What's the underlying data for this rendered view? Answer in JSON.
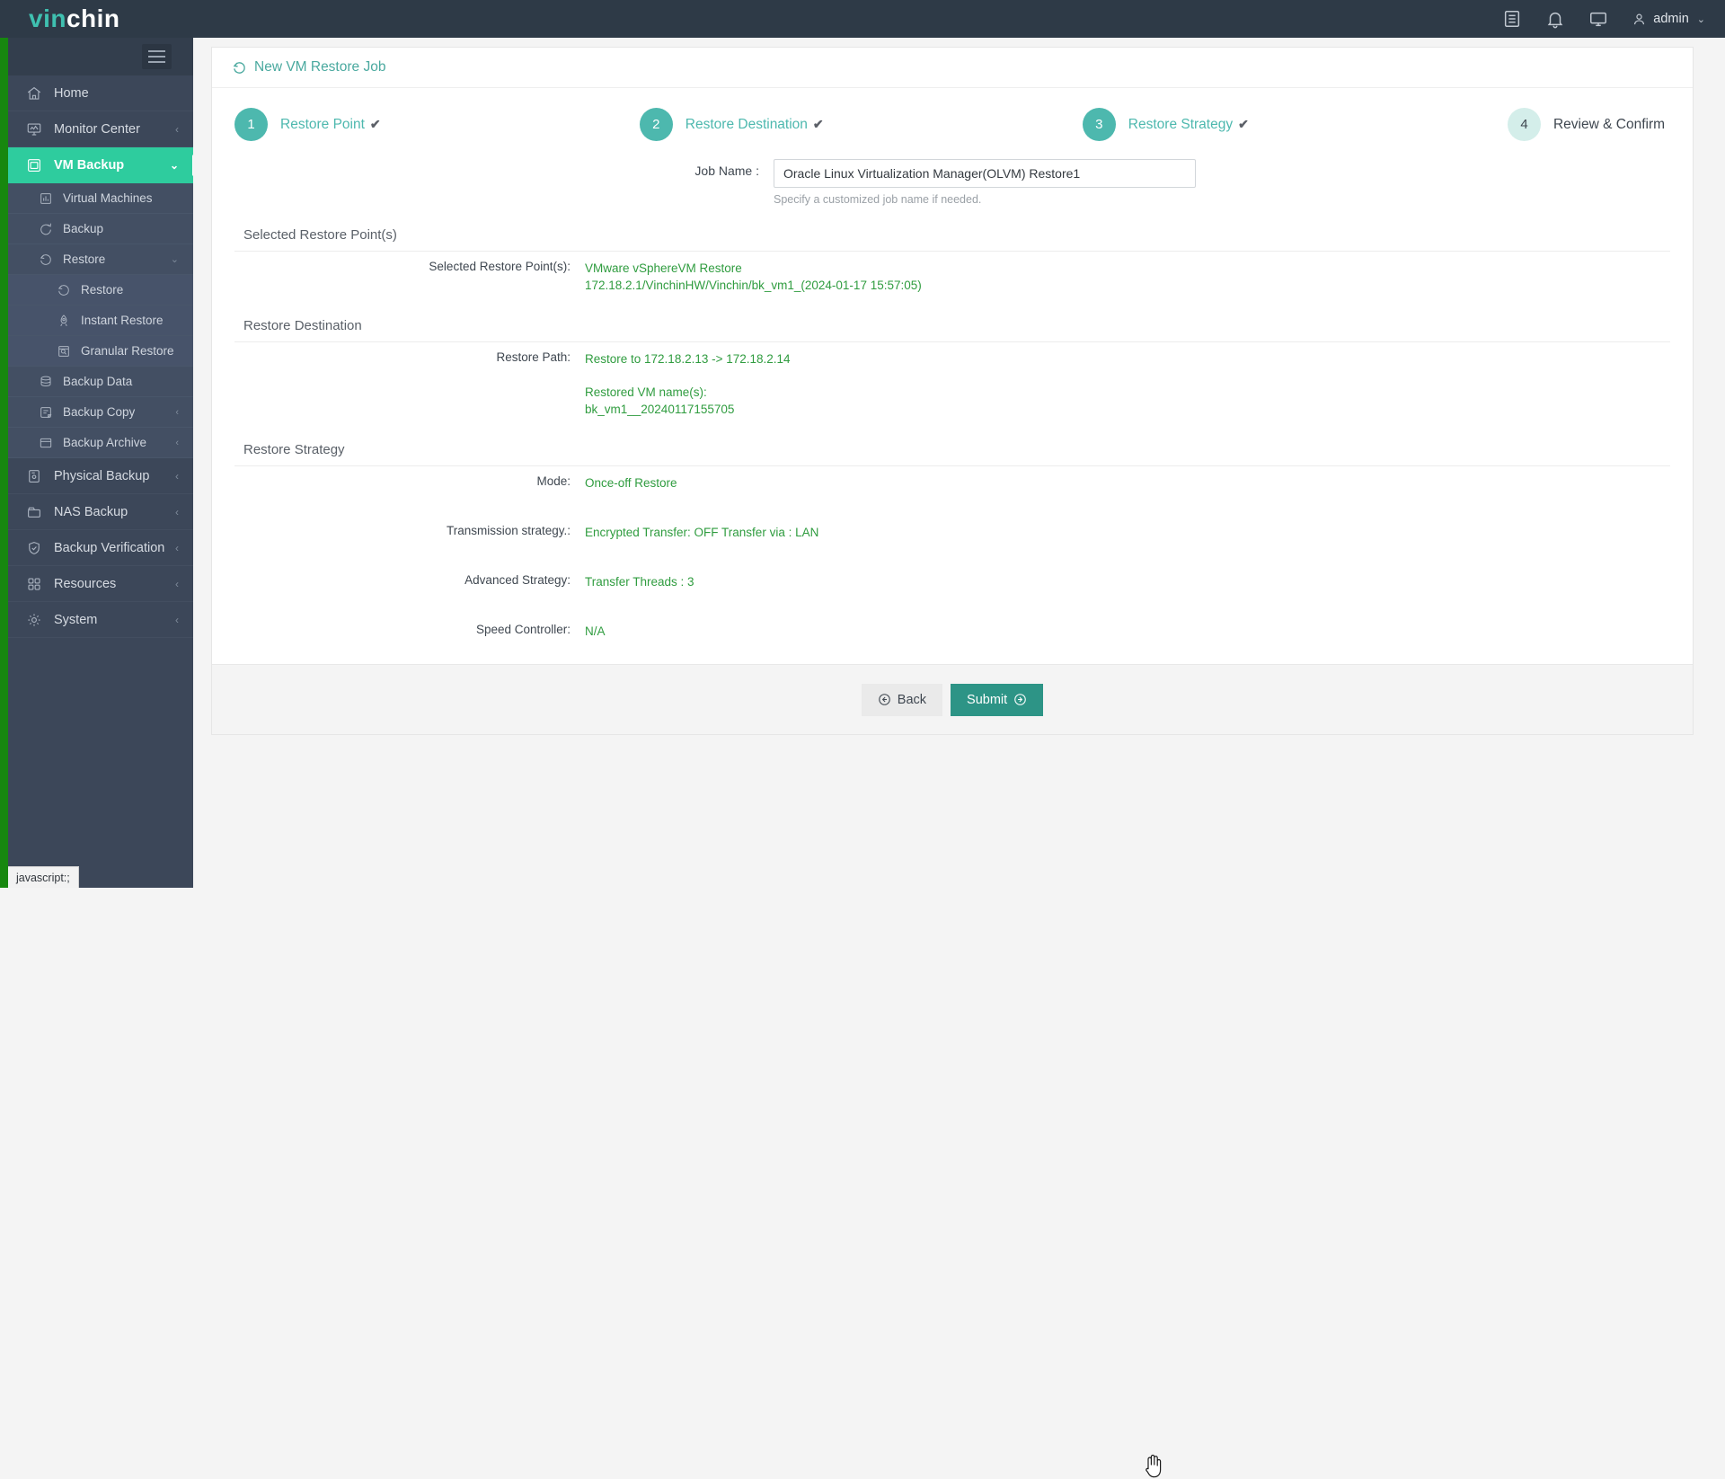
{
  "header": {
    "logo_part1": "vin",
    "logo_part2": "chin",
    "icons": [
      "list-icon",
      "bell-icon",
      "monitor-icon"
    ],
    "user_name": "admin",
    "user_chevron": "⌄"
  },
  "sidebar": {
    "toggle": "hamburger-icon",
    "items": [
      {
        "label": "Home",
        "icon": "home-icon",
        "arrow": "",
        "level": 0,
        "active": false
      },
      {
        "label": "Monitor Center",
        "icon": "monitor-chart-icon",
        "arrow": "‹",
        "level": 0,
        "active": false
      },
      {
        "label": "VM Backup",
        "icon": "vm-icon",
        "arrow": "⌄",
        "level": 0,
        "active": true
      },
      {
        "label": "Virtual Machines",
        "icon": "grid-icon",
        "arrow": "",
        "level": 1,
        "active": false
      },
      {
        "label": "Backup",
        "icon": "refresh-icon",
        "arrow": "",
        "level": 1,
        "active": false
      },
      {
        "label": "Restore",
        "icon": "restore-icon",
        "arrow": "⌄",
        "level": 1,
        "active": false
      },
      {
        "label": "Restore",
        "icon": "restore-icon",
        "arrow": "",
        "level": 2,
        "active": false
      },
      {
        "label": "Instant Restore",
        "icon": "rocket-icon",
        "arrow": "",
        "level": 2,
        "active": false
      },
      {
        "label": "Granular Restore",
        "icon": "file-search-icon",
        "arrow": "",
        "level": 2,
        "active": false
      },
      {
        "label": "Backup Data",
        "icon": "database-icon",
        "arrow": "",
        "level": 1,
        "active": false
      },
      {
        "label": "Backup Copy",
        "icon": "copy-icon",
        "arrow": "‹",
        "level": 1,
        "active": false
      },
      {
        "label": "Backup Archive",
        "icon": "archive-icon",
        "arrow": "‹",
        "level": 1,
        "active": false
      },
      {
        "label": "Physical Backup",
        "icon": "server-icon",
        "arrow": "‹",
        "level": 0,
        "active": false
      },
      {
        "label": "NAS Backup",
        "icon": "nas-icon",
        "arrow": "‹",
        "level": 0,
        "active": false
      },
      {
        "label": "Backup Verification",
        "icon": "shield-check-icon",
        "arrow": "‹",
        "level": 0,
        "active": false
      },
      {
        "label": "Resources",
        "icon": "blocks-icon",
        "arrow": "‹",
        "level": 0,
        "active": false
      },
      {
        "label": "System",
        "icon": "gear-icon",
        "arrow": "‹",
        "level": 0,
        "active": false
      }
    ]
  },
  "page": {
    "title": "New VM Restore Job",
    "title_icon": "restore-icon"
  },
  "steps": [
    {
      "number": "1",
      "label": "Restore Point",
      "tick": "✔",
      "state": "done"
    },
    {
      "number": "2",
      "label": "Restore Destination",
      "tick": "✔",
      "state": "done"
    },
    {
      "number": "3",
      "label": "Restore Strategy",
      "tick": "✔",
      "state": "done"
    },
    {
      "number": "4",
      "label": "Review & Confirm",
      "tick": "",
      "state": "pending"
    }
  ],
  "form": {
    "job_name_label": "Job Name :",
    "job_name_value": "Oracle Linux Virtualization Manager(OLVM) Restore1",
    "job_name_placeholder": "Specify a customized job name",
    "job_name_hint": "Specify a customized job name if needed."
  },
  "sections": [
    {
      "heading": "Selected Restore Point(s)",
      "rows": [
        {
          "label": "Selected Restore Point(s):",
          "lines": [
            "VMware vSphereVM Restore",
            "172.18.2.1/VinchinHW/Vinchin/bk_vm1_(2024-01-17 15:57:05)"
          ]
        }
      ]
    },
    {
      "heading": "Restore Destination",
      "rows": [
        {
          "label": "Restore Path:",
          "lines": [
            "Restore to 172.18.2.13 -> 172.18.2.14"
          ]
        },
        {
          "label": "",
          "lines": [
            "Restored VM name(s):",
            "bk_vm1__20240117155705"
          ]
        }
      ]
    },
    {
      "heading": "Restore Strategy",
      "rows": [
        {
          "label": "Mode:",
          "lines": [
            "Once-off Restore"
          ]
        },
        {
          "label": "Transmission strategy.:",
          "lines": [
            "Encrypted Transfer: OFF Transfer via : LAN"
          ]
        },
        {
          "label": "Advanced Strategy:",
          "lines": [
            "Transfer Threads : 3"
          ]
        },
        {
          "label": "Speed Controller:",
          "lines": [
            "N/A"
          ]
        }
      ]
    }
  ],
  "footer": {
    "back_label": "Back",
    "submit_label": "Submit"
  },
  "statusbar": {
    "text": "javascript:;"
  },
  "colors": {
    "accent_teal": "#2ecc9e",
    "step_teal": "#4db8ae",
    "value_green": "#2f9c3f",
    "sidebar_bg": "#3c4759",
    "header_bg": "#2e3a47",
    "rail_green": "#17870f",
    "submit_bg": "#2d9486"
  }
}
